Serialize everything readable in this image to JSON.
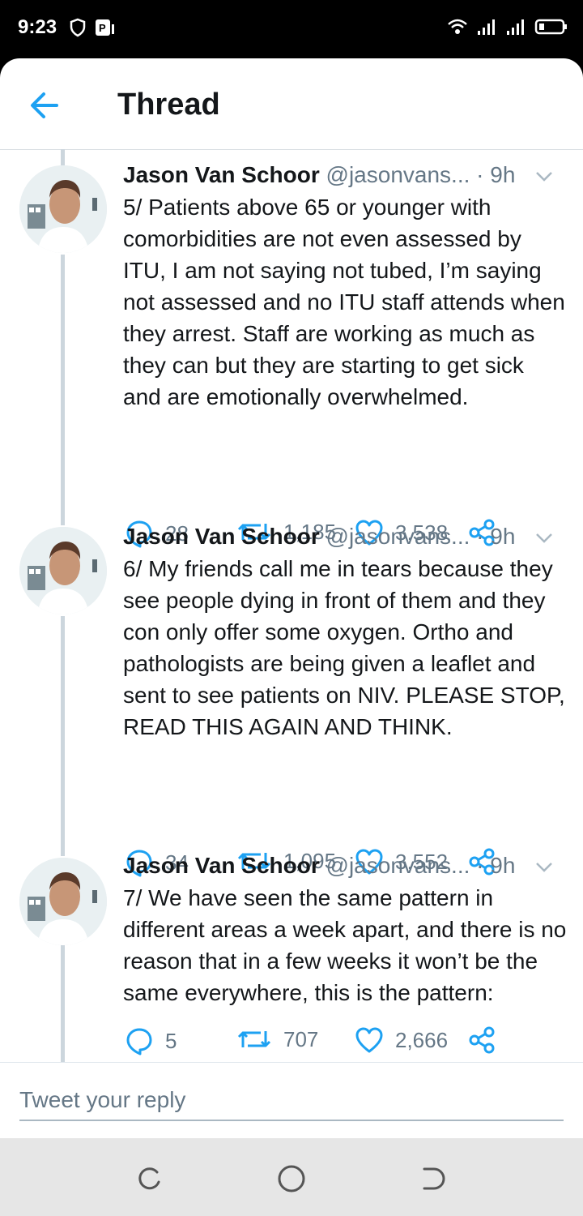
{
  "status_bar": {
    "time": "9:23",
    "left_icons": [
      "shield-icon",
      "sim-icon"
    ],
    "right_icons": [
      "wifi-icon",
      "signal-icon",
      "signal-icon",
      "battery-icon"
    ]
  },
  "header": {
    "back_icon": "arrow-left-icon",
    "title": "Thread"
  },
  "colors": {
    "accent": "#1da1f2",
    "text": "#14171a",
    "secondary": "#657786",
    "thread_line": "#ccd6dd"
  },
  "tweets": [
    {
      "author": "Jason Van Schoor",
      "handle": "@jasonvans...",
      "time": "· 9h",
      "text": "5/ Patients above 65 or younger with comorbidities are not even assessed by ITU, I am not saying not tubed, I’m saying not assessed and no ITU staff attends when they arrest. Staff are working as much as they can but they are starting to get sick and are emotionally overwhelmed.",
      "replies": "28",
      "retweets": "1,185",
      "likes": "3,538"
    },
    {
      "author": "Jason Van Schoor",
      "handle": "@jasonvans...",
      "time": "· 9h",
      "text": "6/ My friends call me in tears because they see people dying in front of them and they con only offer some oxygen. Ortho and pathologists are being given a leaflet and sent to see patients on NIV. PLEASE STOP, READ THIS AGAIN AND THINK.",
      "replies": "34",
      "retweets": "1,095",
      "likes": "3,552"
    },
    {
      "author": "Jason Van Schoor",
      "handle": "@jasonvans...",
      "time": "· 9h",
      "text": "7/ We have seen the same pattern in different areas a week apart, and there is no reason that in a few weeks it won’t be the same everywhere, this is the pattern:",
      "replies": "5",
      "retweets": "707",
      "likes": "2,666"
    }
  ],
  "reply": {
    "placeholder": "Tweet your reply"
  },
  "nav_bar": {
    "icons": [
      "recent-apps-icon",
      "home-icon",
      "back-icon"
    ]
  }
}
